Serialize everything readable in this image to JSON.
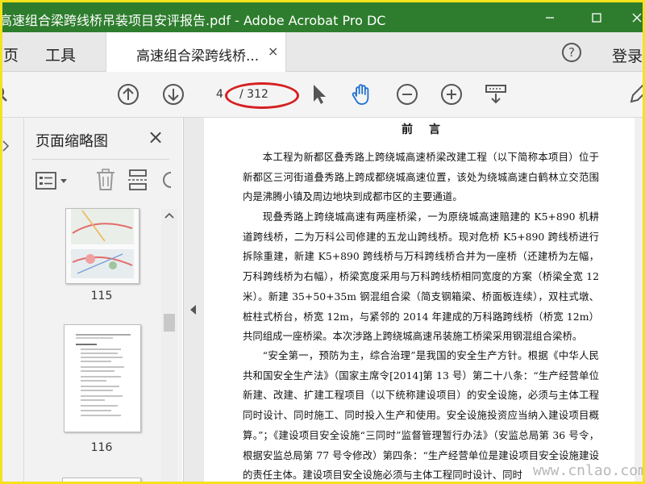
{
  "window": {
    "title": "高速组合梁跨线桥吊装项目安评报告.pdf - Adobe Acrobat Pro DC"
  },
  "tabs": {
    "home": "页",
    "tools": "工具",
    "document": "高速组合梁跨线桥...",
    "close_glyph": "×",
    "help_glyph": "?",
    "login": "登录"
  },
  "toolbar": {
    "current_page": "4",
    "total_pages": "/ 312"
  },
  "thumb_panel": {
    "title": "页面缩略图",
    "close_glyph": "×",
    "pages": [
      "115",
      "116"
    ]
  },
  "document": {
    "heading": "前言",
    "paragraphs": [
      "本工程为新都区叠秀路上跨绕城高速桥梁改建工程（以下简称本项目）位于新都区三河街道叠秀路上跨成都绕城高速位置，该处为绕城高速白鹤林立交范围内是沸腾小镇及周边地块到成都市区的主要通道。",
      "现叠秀路上跨绕城高速有两座桥梁，一为原绕城高速赔建的 K5+890 机耕道跨线桥，二为万科公司修建的五龙山跨线桥。现对危桥 K5+890 跨线桥进行拆除重建，新建 K5+890 跨线桥与万科跨线桥合并为一座桥（还建桥为左幅，万科跨线桥为右幅），桥梁宽度采用与万科跨线桥相同宽度的方案（桥梁全宽 12 米）。新建 35+50+35m 钢混组合梁（简支钢箱梁、桥面板连续），双柱式墩、桩柱式桥台，桥宽 12m，与紧邻的 2014 年建成的万科路跨线桥（桥宽 12m）共同组成一座桥梁。本次涉路上跨绕城高速吊装施工桥梁采用钢混组合梁桥。",
      "“安全第一，预防为主，综合治理”是我国的安全生产方针。根据《中华人民共和国安全生产法》（国家主席令[2014]第 13 号）第二十八条：“生产经营单位新建、改建、扩建工程项目（以下统称建设项目）的安全设施，必须与主体工程同时设计、同时施工、同时投入生产和使用。安全设施投资应当纳入建设项目概算。”；《建设项目安全设施“三同时”监督管理暂行办法》（安监总局第 36 号令，根据安监总局第 77 号令修改）第四条：“生产经营单位是建设项目安全设施建设的责任主体。建设项目安全设施必须与主体工程同时设计、同时"
    ]
  },
  "watermark": "www.cnlao.com",
  "colors": {
    "titlebar": "#2e7d2e",
    "accent_blue": "#1f6fd1",
    "highlight_red": "#d52020",
    "frame_yellow": "#f5e21b"
  }
}
